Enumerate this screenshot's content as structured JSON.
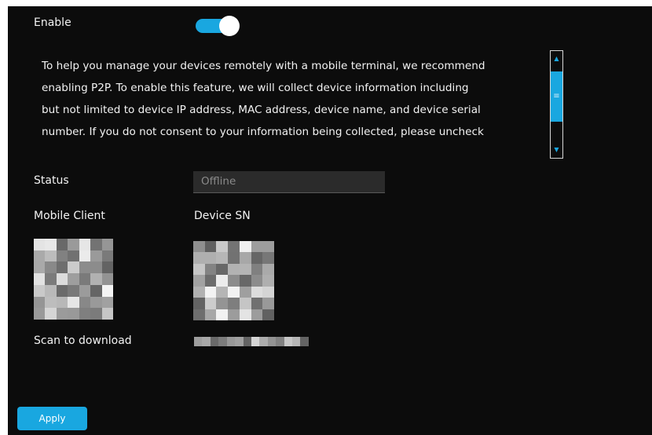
{
  "enable": {
    "label": "Enable",
    "on": true
  },
  "notice": {
    "lines": [
      "To help you manage your devices remotely with a  mobile terminal, we recommend",
      " enabling P2P. To enable this feature, we will collect device information including",
      "but not limited to device IP address, MAC address, device name, and device serial",
      "number. If you do not consent to your information being collected, please uncheck"
    ]
  },
  "status": {
    "label": "Status",
    "value": "Offline"
  },
  "mobile_client": {
    "label": "Mobile Client",
    "scan_label": "Scan to download"
  },
  "device_sn": {
    "label": "Device SN"
  },
  "apply_label": "Apply",
  "colors": {
    "accent": "#19a7e0",
    "background": "#0c0c0c"
  }
}
